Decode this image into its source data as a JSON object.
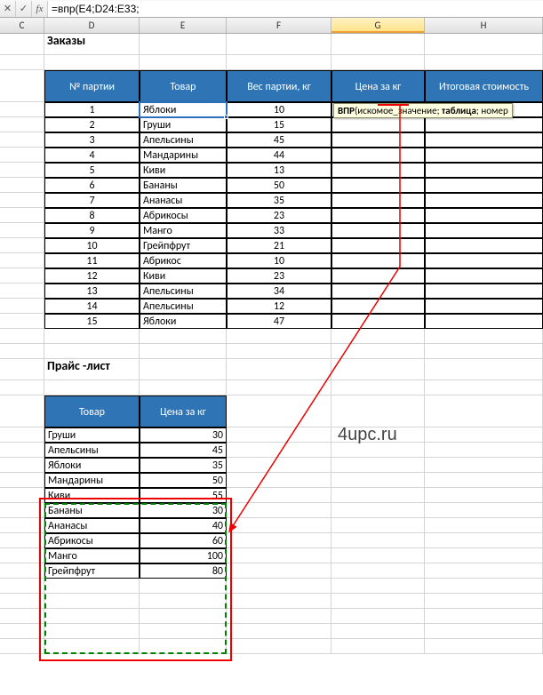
{
  "formula_bar": {
    "cancel": "✕",
    "enter": "✓",
    "fx": "fx",
    "value": "=впр(E4;D24:E33;"
  },
  "cols": {
    "C": "C",
    "D": "D",
    "E": "E",
    "F": "F",
    "G": "G",
    "H": "H"
  },
  "titles": {
    "orders": "Заказы",
    "price": "Прайс -лист"
  },
  "watermark": "4upc.ru",
  "orders_headers": {
    "n": "№ партии",
    "prod": "Товар",
    "weight": "Вес партии, кг",
    "price": "Цена за кг",
    "total": "Итоговая стоимость"
  },
  "g4_parts": {
    "p1": "=впр(",
    "p2": "E4",
    "p3": ";",
    "p4": "D24:E33",
    "p5": ";"
  },
  "tooltip": {
    "fn": "ВПР",
    "a1": "искомое_значение",
    "a2": "таблица",
    "rest": "; номер"
  },
  "orders": [
    {
      "n": "1",
      "prod": "Яблоки",
      "w": "10"
    },
    {
      "n": "2",
      "prod": "Груши",
      "w": "15"
    },
    {
      "n": "3",
      "prod": "Апельсины",
      "w": "45"
    },
    {
      "n": "4",
      "prod": "Мандарины",
      "w": "44"
    },
    {
      "n": "5",
      "prod": "Киви",
      "w": "13"
    },
    {
      "n": "6",
      "prod": "Бананы",
      "w": "50"
    },
    {
      "n": "7",
      "prod": "Ананасы",
      "w": "35"
    },
    {
      "n": "8",
      "prod": "Абрикосы",
      "w": "23"
    },
    {
      "n": "9",
      "prod": "Манго",
      "w": "33"
    },
    {
      "n": "10",
      "prod": "Грейпфрут",
      "w": "21"
    },
    {
      "n": "11",
      "prod": "Абрикос",
      "w": "10"
    },
    {
      "n": "12",
      "prod": "Киви",
      "w": "23"
    },
    {
      "n": "13",
      "prod": "Апельсины",
      "w": "34"
    },
    {
      "n": "14",
      "prod": "Апельсины",
      "w": "12"
    },
    {
      "n": "15",
      "prod": "Яблоки",
      "w": "47"
    }
  ],
  "price_headers": {
    "prod": "Товар",
    "price": "Цена за кг"
  },
  "prices": [
    {
      "prod": "Груши",
      "val": "30"
    },
    {
      "prod": "Апельсины",
      "val": "45"
    },
    {
      "prod": "Яблоки",
      "val": "35"
    },
    {
      "prod": "Мандарины",
      "val": "50"
    },
    {
      "prod": "Киви",
      "val": "55"
    },
    {
      "prod": "Бананы",
      "val": "30"
    },
    {
      "prod": "Ананасы",
      "val": "40"
    },
    {
      "prod": "Абрикосы",
      "val": "60"
    },
    {
      "prod": "Манго",
      "val": "100"
    },
    {
      "prod": "Грейпфрут",
      "val": "80"
    }
  ],
  "chart_data": {
    "type": "table",
    "tables": [
      {
        "title": "Заказы",
        "columns": [
          "№ партии",
          "Товар",
          "Вес партии, кг",
          "Цена за кг",
          "Итоговая стоимость"
        ],
        "rows": [
          [
            1,
            "Яблоки",
            10,
            null,
            null
          ],
          [
            2,
            "Груши",
            15,
            null,
            null
          ],
          [
            3,
            "Апельсины",
            45,
            null,
            null
          ],
          [
            4,
            "Мандарины",
            44,
            null,
            null
          ],
          [
            5,
            "Киви",
            13,
            null,
            null
          ],
          [
            6,
            "Бананы",
            50,
            null,
            null
          ],
          [
            7,
            "Ананасы",
            35,
            null,
            null
          ],
          [
            8,
            "Абрикосы",
            23,
            null,
            null
          ],
          [
            9,
            "Манго",
            33,
            null,
            null
          ],
          [
            10,
            "Грейпфрут",
            21,
            null,
            null
          ],
          [
            11,
            "Абрикос",
            10,
            null,
            null
          ],
          [
            12,
            "Киви",
            23,
            null,
            null
          ],
          [
            13,
            "Апельсины",
            34,
            null,
            null
          ],
          [
            14,
            "Апельсины",
            12,
            null,
            null
          ],
          [
            15,
            "Яблоки",
            47,
            null,
            null
          ]
        ]
      },
      {
        "title": "Прайс -лист",
        "columns": [
          "Товар",
          "Цена за кг"
        ],
        "rows": [
          [
            "Груши",
            30
          ],
          [
            "Апельсины",
            45
          ],
          [
            "Яблоки",
            35
          ],
          [
            "Мандарины",
            50
          ],
          [
            "Киви",
            55
          ],
          [
            "Бананы",
            30
          ],
          [
            "Ананасы",
            40
          ],
          [
            "Абрикосы",
            60
          ],
          [
            "Манго",
            100
          ],
          [
            "Грейпфрут",
            80
          ]
        ]
      }
    ]
  }
}
